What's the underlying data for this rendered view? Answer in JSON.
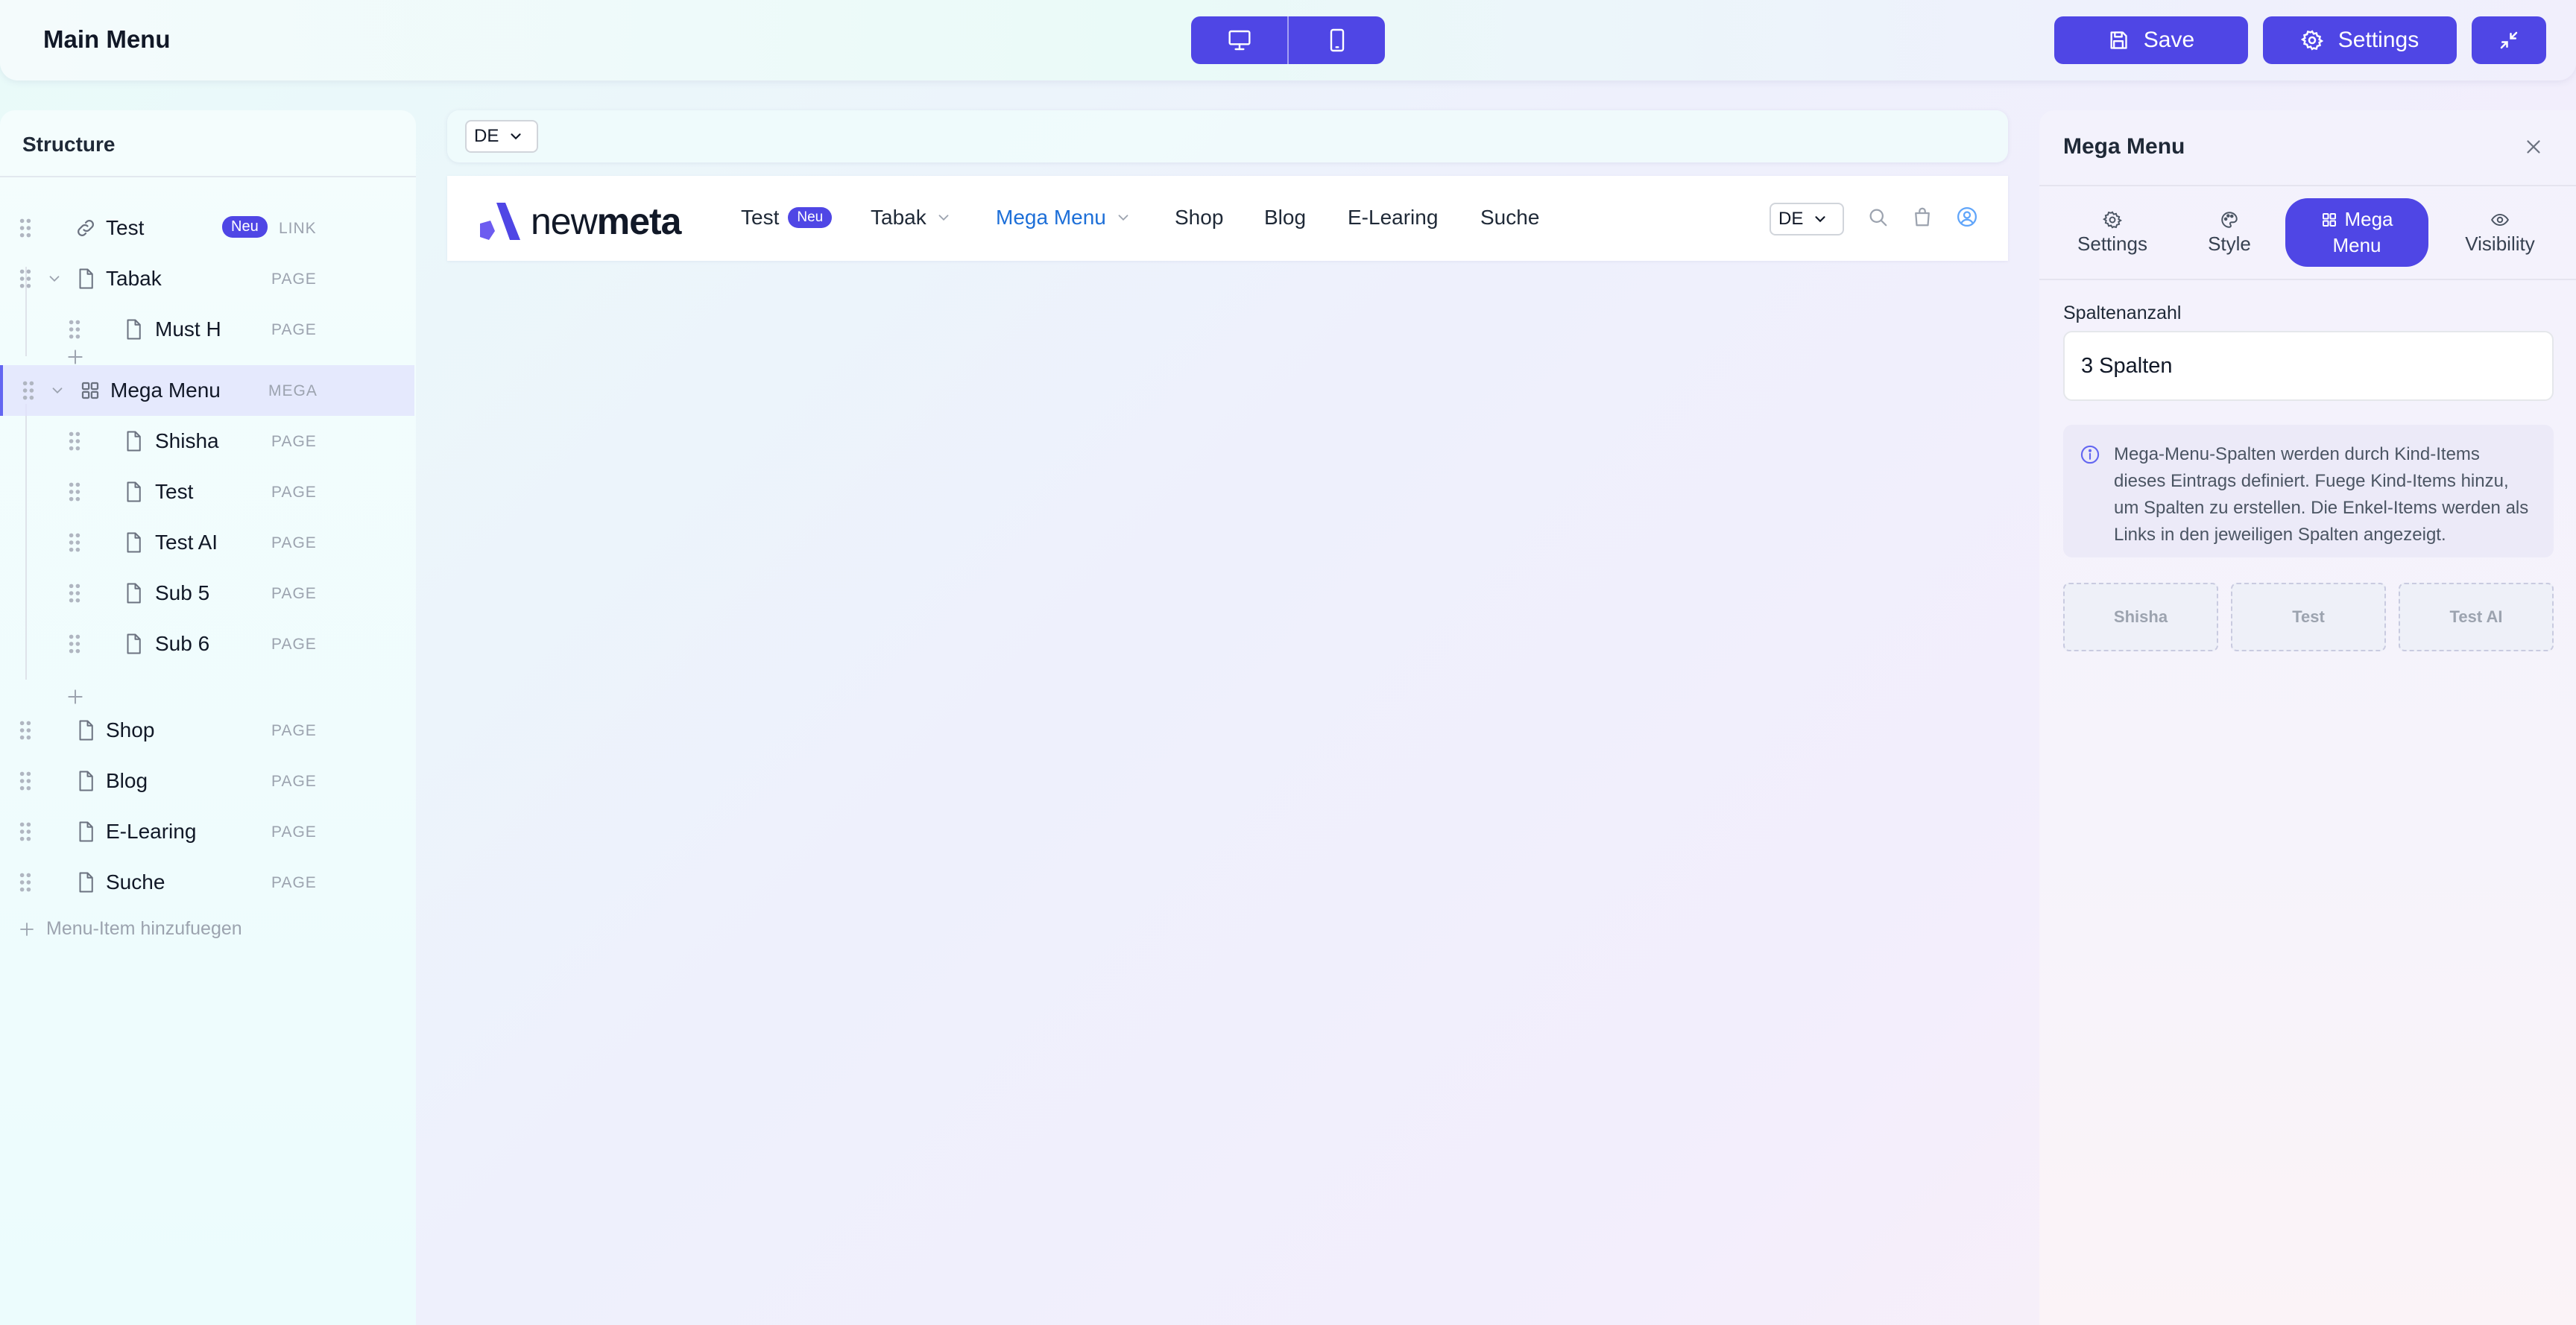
{
  "header": {
    "title": "Main Menu",
    "save_label": "Save",
    "settings_label": "Settings"
  },
  "sidebar": {
    "title": "Structure",
    "add_item_label": "Menu-Item hinzufuegen",
    "items": [
      {
        "label": "Test",
        "badge": "Neu",
        "type": "LINK",
        "icon": "link-icon"
      },
      {
        "label": "Tabak",
        "type": "PAGE",
        "icon": "page-icon"
      },
      {
        "label": "Must H",
        "type": "PAGE",
        "icon": "page-icon"
      },
      {
        "label": "Mega Menu",
        "type": "MEGA",
        "icon": "grid-icon"
      },
      {
        "label": "Shisha",
        "type": "PAGE",
        "icon": "page-icon"
      },
      {
        "label": "Test",
        "type": "PAGE",
        "icon": "page-icon"
      },
      {
        "label": "Test AI",
        "type": "PAGE",
        "icon": "page-icon"
      },
      {
        "label": "Sub 5",
        "type": "PAGE",
        "icon": "page-icon"
      },
      {
        "label": "Sub 6",
        "type": "PAGE",
        "icon": "page-icon"
      },
      {
        "label": "Shop",
        "type": "PAGE",
        "icon": "page-icon"
      },
      {
        "label": "Blog",
        "type": "PAGE",
        "icon": "page-icon"
      },
      {
        "label": "E-Learing",
        "type": "PAGE",
        "icon": "page-icon"
      },
      {
        "label": "Suche",
        "type": "PAGE",
        "icon": "page-icon"
      }
    ]
  },
  "canvas": {
    "language": "DE",
    "preview": {
      "logo": {
        "part1": "new",
        "part2": "meta"
      },
      "language": "DE",
      "nav": [
        {
          "label": "Test",
          "badge": "Neu"
        },
        {
          "label": "Tabak"
        },
        {
          "label": "Mega Menu"
        },
        {
          "label": "Shop"
        },
        {
          "label": "Blog"
        },
        {
          "label": "E-Learing"
        },
        {
          "label": "Suche"
        }
      ]
    }
  },
  "panel": {
    "title": "Mega Menu",
    "tabs": [
      {
        "label": "Settings",
        "icon": "gear-icon"
      },
      {
        "label": "Style",
        "icon": "palette-icon"
      },
      {
        "label": "Mega",
        "label2": "Menu",
        "icon": "grid-icon"
      },
      {
        "label": "Visibility",
        "icon": "eye-icon"
      }
    ],
    "columns_label": "Spaltenanzahl",
    "columns_value": "3 Spalten",
    "info_text": "Mega-Menu-Spalten werden durch Kind-Items dieses Eintrags definiert. Fuege Kind-Items hinzu, um Spalten zu erstellen. Die Enkel-Items werden als Links in den jeweiligen Spalten angezeigt.",
    "column_previews": [
      "Shisha",
      "Test",
      "Test AI"
    ]
  },
  "colors": {
    "accent": "#4f46e5",
    "active_link": "#1d6fd8"
  }
}
